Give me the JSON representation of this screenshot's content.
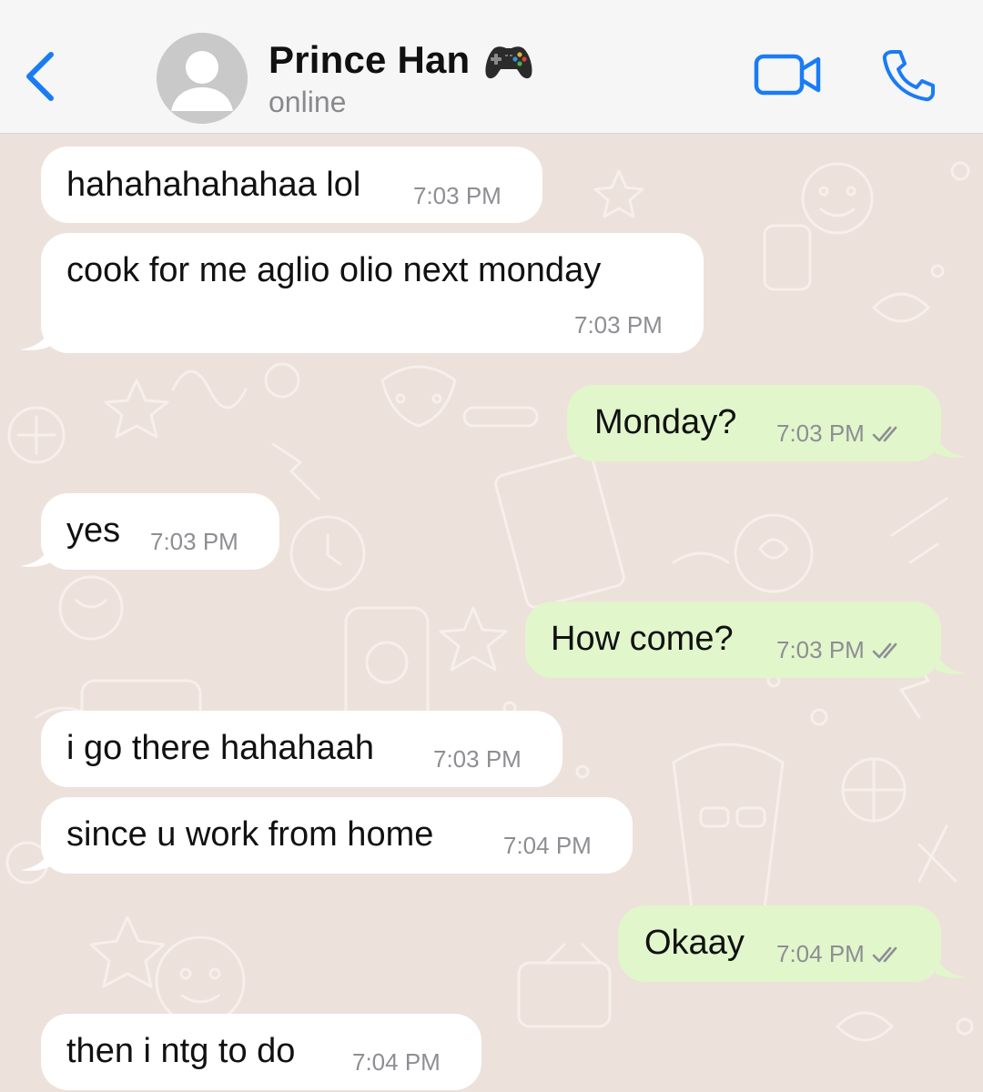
{
  "header": {
    "contact_name": "Prince Han",
    "name_emoji": "game-controller-icon",
    "status": "online",
    "accent_color": "#1a7cf5"
  },
  "messages": [
    {
      "direction": "incoming",
      "text": "hahahahahahaa lol",
      "time": "7:03 PM"
    },
    {
      "direction": "incoming",
      "text": "cook for me aglio olio next monday",
      "time": "7:03 PM"
    },
    {
      "direction": "outgoing",
      "text": "Monday?",
      "time": "7:03 PM",
      "status": "read-double-check"
    },
    {
      "direction": "incoming",
      "text": "yes",
      "time": "7:03 PM"
    },
    {
      "direction": "outgoing",
      "text": "How come?",
      "time": "7:03 PM",
      "status": "read-double-check"
    },
    {
      "direction": "incoming",
      "text": "i go there hahahaah",
      "time": "7:03 PM"
    },
    {
      "direction": "incoming",
      "text": "since u work from home",
      "time": "7:04 PM"
    },
    {
      "direction": "outgoing",
      "text": "Okaay",
      "time": "7:04 PM",
      "status": "read-double-check"
    },
    {
      "direction": "incoming",
      "text": "then i ntg to do",
      "time": "7:04 PM"
    }
  ],
  "colors": {
    "incoming_bubble": "#ffffff",
    "outgoing_bubble": "#e1f6cb",
    "chat_background": "#ede1db"
  }
}
